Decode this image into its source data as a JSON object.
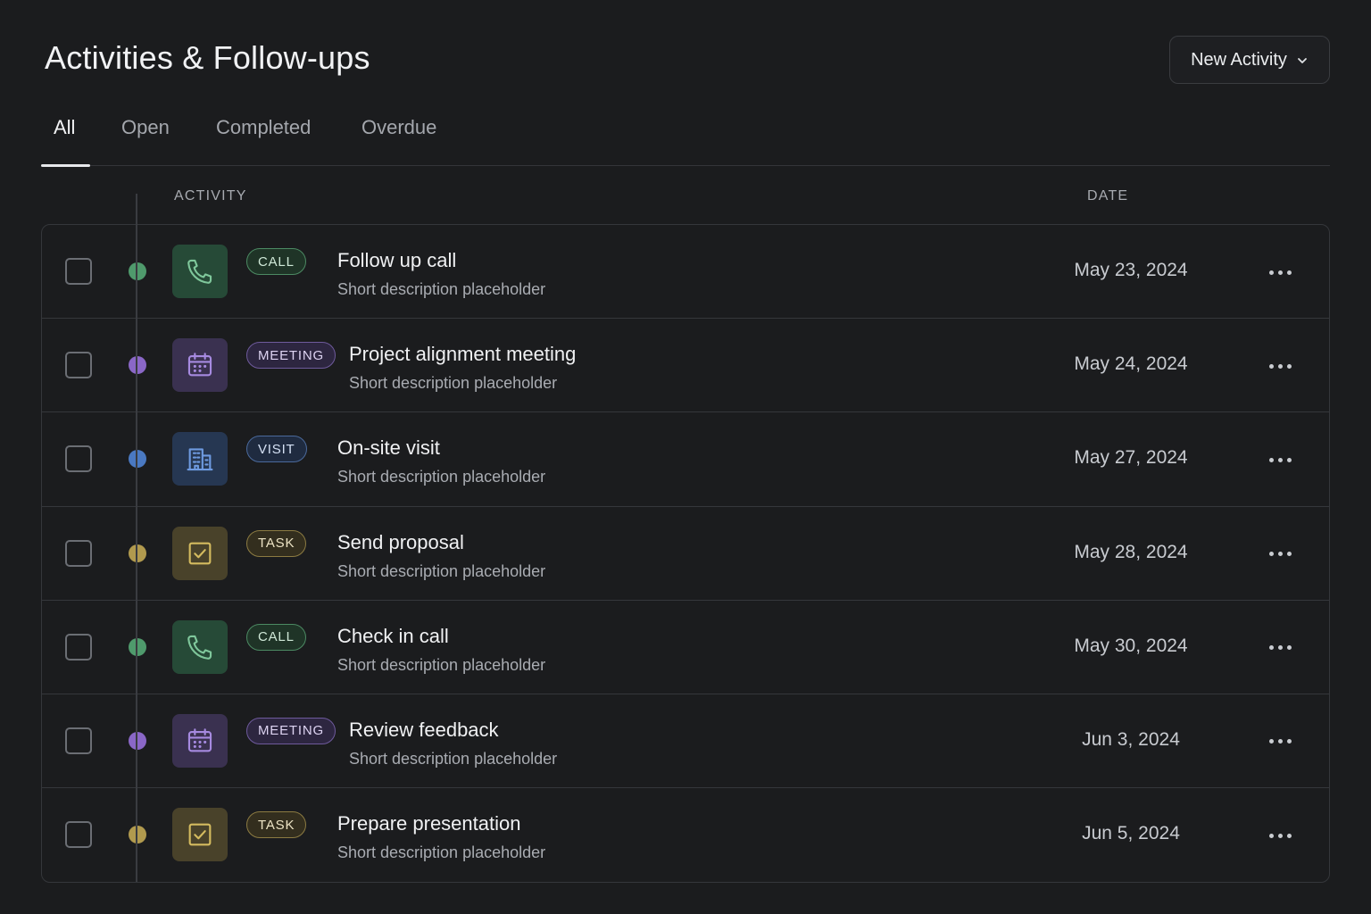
{
  "header": {
    "title": "Activities & Follow-ups",
    "new_button_label": "New Activity"
  },
  "tabs": [
    {
      "label": "All",
      "active": true
    },
    {
      "label": "Open",
      "active": false
    },
    {
      "label": "Completed",
      "active": false
    },
    {
      "label": "Overdue",
      "active": false
    }
  ],
  "columns": {
    "activity": "ACTIVITY",
    "date": "DATE"
  },
  "colors": {
    "call": "#4f9a6c",
    "meeting": "#8a67c7",
    "visit": "#4a79c2",
    "task": "#b19a4e"
  },
  "activities": [
    {
      "type": "call",
      "badge": "CALL",
      "icon": "phone-icon",
      "title": "Follow up call",
      "description": "Short description placeholder",
      "date": "May 23, 2024",
      "checked": false
    },
    {
      "type": "meeting",
      "badge": "MEETING",
      "icon": "calendar-icon",
      "title": "Project alignment meeting",
      "description": "Short description placeholder",
      "date": "May 24, 2024",
      "checked": false
    },
    {
      "type": "visit",
      "badge": "VISIT",
      "icon": "building-icon",
      "title": "On-site visit",
      "description": "Short description placeholder",
      "date": "May 27, 2024",
      "checked": false
    },
    {
      "type": "task",
      "badge": "TASK",
      "icon": "task-check-icon",
      "title": "Send proposal",
      "description": "Short description placeholder",
      "date": "May 28, 2024",
      "checked": false
    },
    {
      "type": "call",
      "badge": "CALL",
      "icon": "phone-icon",
      "title": "Check in call",
      "description": "Short description placeholder",
      "date": "May 30, 2024",
      "checked": false
    },
    {
      "type": "meeting",
      "badge": "MEETING",
      "icon": "calendar-icon",
      "title": "Review feedback",
      "description": "Short description placeholder",
      "date": "Jun 3, 2024",
      "checked": false
    },
    {
      "type": "task",
      "badge": "TASK",
      "icon": "task-check-icon",
      "title": "Prepare presentation",
      "description": "Short description placeholder",
      "date": "Jun 5, 2024",
      "checked": false
    }
  ]
}
